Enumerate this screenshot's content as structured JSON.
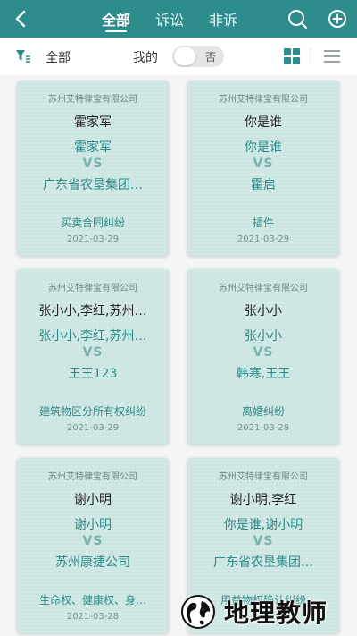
{
  "header": {
    "tabs": [
      {
        "label": "全部",
        "active": true
      },
      {
        "label": "诉讼",
        "active": false
      },
      {
        "label": "非诉",
        "active": false
      }
    ],
    "icons": [
      "back-arrow-icon",
      "search-icon",
      "add-circle-icon"
    ]
  },
  "filter": {
    "filter_label": "全部",
    "mine_label": "我的",
    "toggle_value": "否",
    "icons": [
      "filter-icon",
      "grid-view-icon",
      "list-view-icon"
    ]
  },
  "cards": [
    {
      "company": "苏州艾特律宝有限公司",
      "title": "霍家军",
      "plaintiff": "霍家军",
      "vs": "VS",
      "defendant": "广东省农垦集团…",
      "cause": "买卖合同纠纷",
      "date": "2021-03-29"
    },
    {
      "company": "苏州艾特律宝有限公司",
      "title": "你是谁",
      "plaintiff": "你是谁",
      "vs": "VS",
      "defendant": "霍启",
      "cause": "插件",
      "date": "2021-03-29"
    },
    {
      "company": "苏州艾特律宝有限公司",
      "title": "张小小,李红,苏州…",
      "plaintiff": "张小小,李红,苏州…",
      "vs": "VS",
      "defendant": "王王123",
      "cause": "建筑物区分所有权纠纷",
      "date": "2021-03-29"
    },
    {
      "company": "苏州艾特律宝有限公司",
      "title": "张小小",
      "plaintiff": "张小小",
      "vs": "VS",
      "defendant": "韩寒,王王",
      "cause": "离婚纠纷",
      "date": "2021-03-28"
    },
    {
      "company": "苏州艾特律宝有限公司",
      "title": "谢小明",
      "plaintiff": "谢小明",
      "vs": "VS",
      "defendant": "苏州康捷公司",
      "cause": "生命权、健康权、身…",
      "date": "2021-03-28"
    },
    {
      "company": "苏州艾特律宝有限公司",
      "title": "谢小明,李红",
      "plaintiff": "你是谁,谢小明",
      "vs": "VS",
      "defendant": "广东省农垦集团…",
      "cause": "用益物权确认纠纷",
      "date": ""
    }
  ],
  "watermark": {
    "text": "地理教师"
  },
  "colors": {
    "primary": "#2d8c8c",
    "card_bg": "#cde6e3",
    "accent_text": "#2a8a86"
  }
}
